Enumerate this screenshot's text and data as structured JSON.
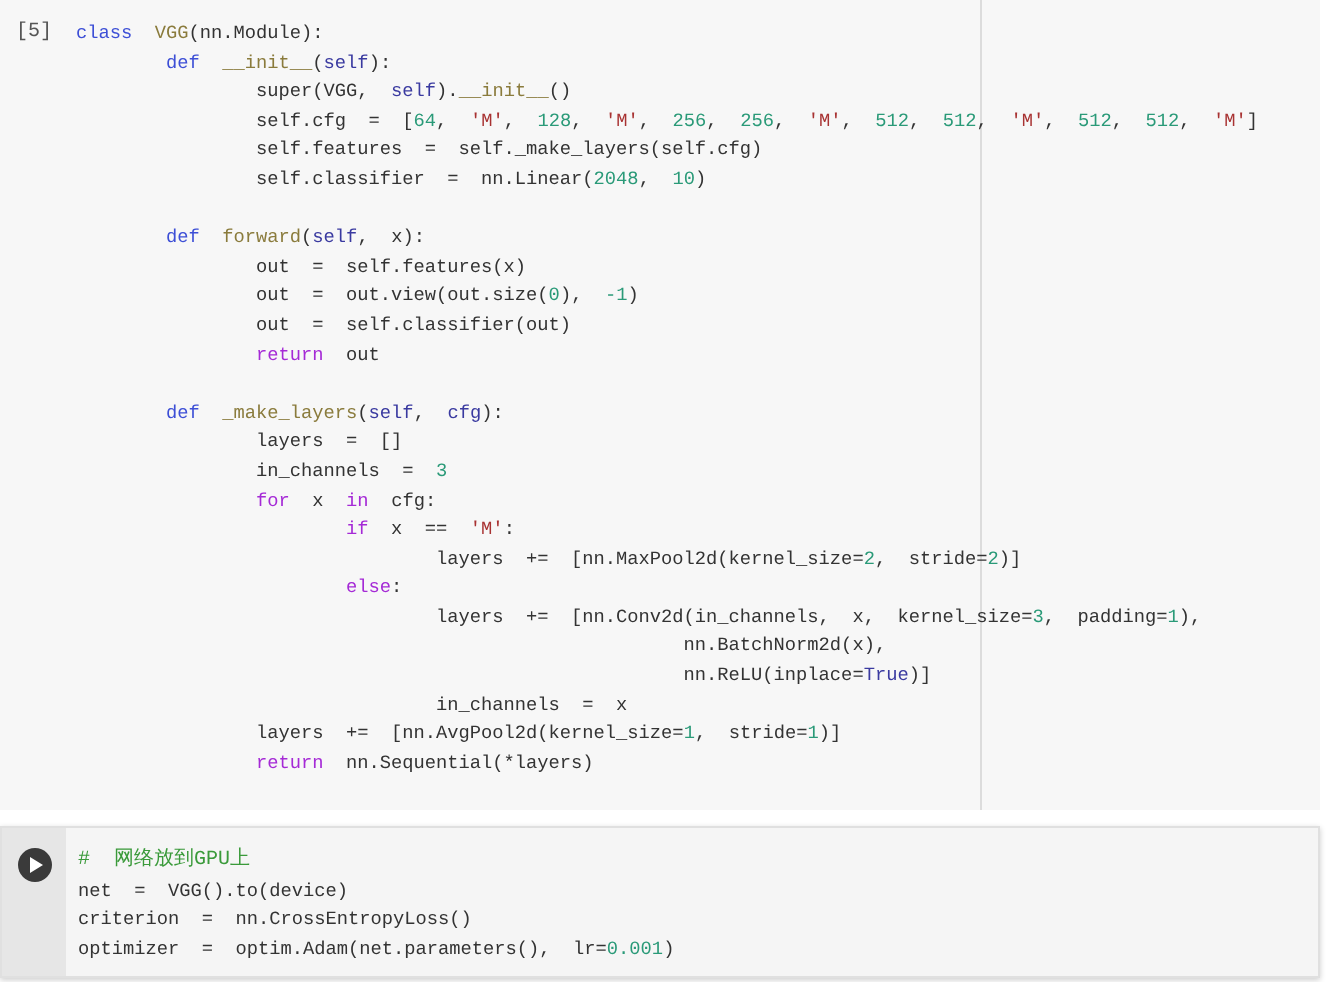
{
  "cells": [
    {
      "kind": "executed",
      "prompt": "[5]",
      "lines": [
        {
          "tokens": [
            {
              "kind": "kw",
              "text": "class"
            },
            {
              "kind": "fn",
              "text": "  VGG"
            },
            {
              "kind": "p",
              "text": "(nn.Module):"
            }
          ]
        },
        {
          "tokens": [
            {
              "kind": "kw",
              "text": "        def"
            },
            {
              "kind": "fn",
              "text": "  __init__"
            },
            {
              "kind": "p",
              "text": "("
            },
            {
              "kind": "s",
              "text": "self"
            },
            {
              "kind": "p",
              "text": "):"
            }
          ]
        },
        {
          "tokens": [
            {
              "kind": "p",
              "text": "                super(VGG,  "
            },
            {
              "kind": "s",
              "text": "self"
            },
            {
              "kind": "p",
              "text": ")."
            },
            {
              "kind": "fn",
              "text": "__init__"
            },
            {
              "kind": "p",
              "text": "()"
            }
          ]
        },
        {
          "tokens": [
            {
              "kind": "p",
              "text": "                self.cfg  =  ["
            },
            {
              "kind": "n",
              "text": "64"
            },
            {
              "kind": "p",
              "text": ",  "
            },
            {
              "kind": "r",
              "text": "'M'"
            },
            {
              "kind": "p",
              "text": ",  "
            },
            {
              "kind": "n",
              "text": "128"
            },
            {
              "kind": "p",
              "text": ",  "
            },
            {
              "kind": "r",
              "text": "'M'"
            },
            {
              "kind": "p",
              "text": ",  "
            },
            {
              "kind": "n",
              "text": "256"
            },
            {
              "kind": "p",
              "text": ",  "
            },
            {
              "kind": "n",
              "text": "256"
            },
            {
              "kind": "p",
              "text": ",  "
            },
            {
              "kind": "r",
              "text": "'M'"
            },
            {
              "kind": "p",
              "text": ",  "
            },
            {
              "kind": "n",
              "text": "512"
            },
            {
              "kind": "p",
              "text": ",  "
            },
            {
              "kind": "n",
              "text": "512"
            },
            {
              "kind": "p",
              "text": ",  "
            },
            {
              "kind": "r",
              "text": "'M'"
            },
            {
              "kind": "p",
              "text": ",  "
            },
            {
              "kind": "n",
              "text": "512"
            },
            {
              "kind": "p",
              "text": ",  "
            },
            {
              "kind": "n",
              "text": "512"
            },
            {
              "kind": "p",
              "text": ",  "
            },
            {
              "kind": "r",
              "text": "'M'"
            },
            {
              "kind": "p",
              "text": "]"
            }
          ]
        },
        {
          "tokens": [
            {
              "kind": "p",
              "text": "                self.features  =  self._make_layers(self.cfg)"
            }
          ]
        },
        {
          "tokens": [
            {
              "kind": "p",
              "text": "                self.classifier  =  nn.Linear("
            },
            {
              "kind": "n",
              "text": "2048"
            },
            {
              "kind": "p",
              "text": ",  "
            },
            {
              "kind": "n",
              "text": "10"
            },
            {
              "kind": "p",
              "text": ")"
            }
          ]
        },
        {
          "kind": "blank"
        },
        {
          "tokens": [
            {
              "kind": "kw",
              "text": "        def"
            },
            {
              "kind": "fn",
              "text": "  forward"
            },
            {
              "kind": "p",
              "text": "("
            },
            {
              "kind": "s",
              "text": "self"
            },
            {
              "kind": "p",
              "text": ",  x):"
            }
          ]
        },
        {
          "tokens": [
            {
              "kind": "p",
              "text": "                out  =  self.features(x)"
            }
          ]
        },
        {
          "tokens": [
            {
              "kind": "p",
              "text": "                out  =  out.view(out.size("
            },
            {
              "kind": "n",
              "text": "0"
            },
            {
              "kind": "p",
              "text": "),  "
            },
            {
              "kind": "n",
              "text": "-1"
            },
            {
              "kind": "p",
              "text": ")"
            }
          ]
        },
        {
          "tokens": [
            {
              "kind": "p",
              "text": "                out  =  self.classifier(out)"
            }
          ]
        },
        {
          "tokens": [
            {
              "kind": "c",
              "text": "                return"
            },
            {
              "kind": "p",
              "text": "  out"
            }
          ]
        },
        {
          "kind": "blank"
        },
        {
          "tokens": [
            {
              "kind": "kw",
              "text": "        def"
            },
            {
              "kind": "fn",
              "text": "  _make_layers"
            },
            {
              "kind": "p",
              "text": "("
            },
            {
              "kind": "s",
              "text": "self"
            },
            {
              "kind": "p",
              "text": ",  "
            },
            {
              "kind": "s",
              "text": "cfg"
            },
            {
              "kind": "p",
              "text": "):"
            }
          ]
        },
        {
          "tokens": [
            {
              "kind": "p",
              "text": "                layers  =  []"
            }
          ]
        },
        {
          "tokens": [
            {
              "kind": "p",
              "text": "                in_channels  =  "
            },
            {
              "kind": "n",
              "text": "3"
            }
          ]
        },
        {
          "tokens": [
            {
              "kind": "c",
              "text": "                for"
            },
            {
              "kind": "p",
              "text": "  x  "
            },
            {
              "kind": "c",
              "text": "in"
            },
            {
              "kind": "p",
              "text": "  cfg:"
            }
          ]
        },
        {
          "tokens": [
            {
              "kind": "c",
              "text": "                        if"
            },
            {
              "kind": "p",
              "text": "  x  ==  "
            },
            {
              "kind": "r",
              "text": "'M'"
            },
            {
              "kind": "p",
              "text": ":"
            }
          ]
        },
        {
          "tokens": [
            {
              "kind": "p",
              "text": "                                layers  +=  [nn.MaxPool2d(kernel_size="
            },
            {
              "kind": "n",
              "text": "2"
            },
            {
              "kind": "p",
              "text": ",  stride="
            },
            {
              "kind": "n",
              "text": "2"
            },
            {
              "kind": "p",
              "text": ")]"
            }
          ]
        },
        {
          "tokens": [
            {
              "kind": "c",
              "text": "                        else"
            },
            {
              "kind": "p",
              "text": ":"
            }
          ]
        },
        {
          "tokens": [
            {
              "kind": "p",
              "text": "                                layers  +=  [nn.Conv2d(in_channels,  x,  kernel_size="
            },
            {
              "kind": "n",
              "text": "3"
            },
            {
              "kind": "p",
              "text": ",  padding="
            },
            {
              "kind": "n",
              "text": "1"
            },
            {
              "kind": "p",
              "text": "),"
            }
          ]
        },
        {
          "tokens": [
            {
              "kind": "p",
              "text": "                                                      nn.BatchNorm2d(x),"
            }
          ]
        },
        {
          "tokens": [
            {
              "kind": "p",
              "text": "                                                      nn.ReLU(inplace="
            },
            {
              "kind": "s",
              "text": "True"
            },
            {
              "kind": "p",
              "text": ")]"
            }
          ]
        },
        {
          "tokens": [
            {
              "kind": "p",
              "text": "                                in_channels  =  x"
            }
          ]
        },
        {
          "tokens": [
            {
              "kind": "p",
              "text": "                layers  +=  [nn.AvgPool2d(kernel_size="
            },
            {
              "kind": "n",
              "text": "1"
            },
            {
              "kind": "p",
              "text": ",  stride="
            },
            {
              "kind": "n",
              "text": "1"
            },
            {
              "kind": "p",
              "text": ")]"
            }
          ]
        },
        {
          "tokens": [
            {
              "kind": "c",
              "text": "                return"
            },
            {
              "kind": "p",
              "text": "  nn.Sequential(*layers)"
            }
          ]
        }
      ]
    },
    {
      "kind": "focused",
      "lines": [
        {
          "tokens": [
            {
              "kind": "co",
              "text": "#  网络放到GPU上"
            }
          ]
        },
        {
          "tokens": [
            {
              "kind": "p",
              "text": "net  =  VGG().to(device)"
            }
          ]
        },
        {
          "tokens": [
            {
              "kind": "p",
              "text": "criterion  =  nn.CrossEntropyLoss()"
            }
          ]
        },
        {
          "tokens": [
            {
              "kind": "p",
              "text": "optimizer  =  optim.Adam(net.parameters(),  lr="
            },
            {
              "kind": "n",
              "text": "0.001"
            },
            {
              "kind": "p",
              "text": ")"
            }
          ]
        }
      ]
    }
  ]
}
